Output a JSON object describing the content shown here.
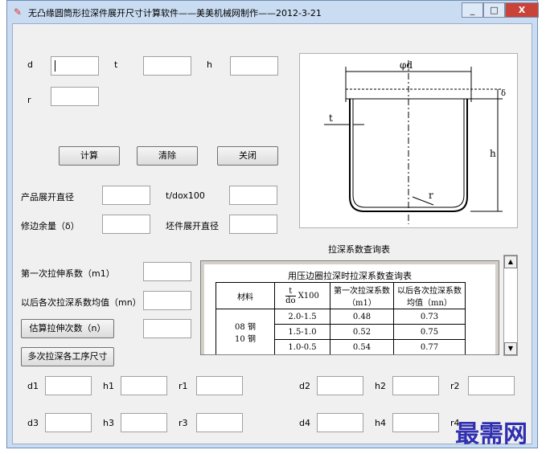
{
  "window": {
    "title": "无凸缘圆筒形拉深件展开尺寸计算软件——美美机械网制作——2012-3-21",
    "icon": "app-icon",
    "controls": {
      "minimize": "_",
      "maximize": "□",
      "close": "X"
    }
  },
  "inputs_top": {
    "d_label": "d",
    "t_label": "t",
    "h_label": "h",
    "r_label": "r",
    "d_value": "",
    "t_value": "",
    "h_value": "",
    "r_value": ""
  },
  "buttons": {
    "calc": "计算",
    "clear": "清除",
    "close": "关闭",
    "estimate": "估算拉伸次数（n）",
    "multi": "多次拉深各工序尺寸"
  },
  "results": {
    "product_diameter_label": "产品展开直径",
    "t_do_label": "t/dox100",
    "trim_label": "修边余量（δ）",
    "blank_label": "坯件展开直径",
    "m1_label": "第一次拉伸系数（m1）",
    "mn_label": "以后各次拉深系数均值（mn）"
  },
  "diagram": {
    "phi_d": "φd",
    "delta": "δ",
    "t": "t",
    "h": "h",
    "r": "r"
  },
  "coef_table": {
    "caption": "拉深系数查询表",
    "title": "用压边圈拉深时拉深系数查询表",
    "headers": [
      "材料",
      "第一次拉深系数（m1）",
      "以后各次拉深系数均值（mn）"
    ],
    "header_formula_num": "t",
    "header_formula_den": "do",
    "header_formula_suffix": "X100",
    "materials": [
      "08 钢",
      "10 钢"
    ],
    "rows": [
      {
        "range": "2.0-1.5",
        "m1": "0.48",
        "mn": "0.73"
      },
      {
        "range": "1.5-1.0",
        "m1": "0.52",
        "mn": "0.75"
      },
      {
        "range": "1.0-0.5",
        "m1": "0.54",
        "mn": "0.77"
      }
    ]
  },
  "process": {
    "row1": [
      "d1",
      "h1",
      "r1",
      "d2",
      "h2",
      "r2"
    ],
    "row2": [
      "d3",
      "h3",
      "r3",
      "d4",
      "h4",
      "r4"
    ]
  },
  "watermark": "最需网"
}
